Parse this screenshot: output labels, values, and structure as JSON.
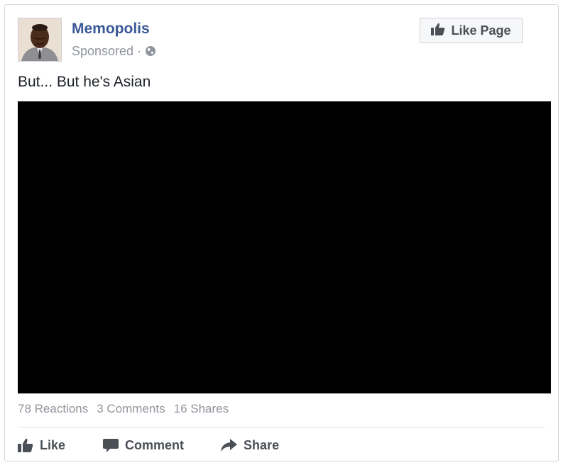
{
  "post": {
    "page_name": "Memopolis",
    "sponsored_label": "Sponsored",
    "separator": "·",
    "text": "But... But he's Asian",
    "like_page_label": "Like Page"
  },
  "stats": {
    "reactions": "78 Reactions",
    "comments": "3 Comments",
    "shares": "16 Shares"
  },
  "actions": {
    "like": "Like",
    "comment": "Comment",
    "share": "Share"
  },
  "icons": {
    "like_page": "thumbs-up-icon",
    "globe": "globe-icon",
    "like": "thumbs-up-icon",
    "comment": "speech-bubble-icon",
    "share": "share-arrow-icon"
  },
  "colors": {
    "page_name": "#3b5998",
    "muted_text": "#90949c",
    "action_text": "#4b4f56",
    "video_background": "#000000"
  }
}
